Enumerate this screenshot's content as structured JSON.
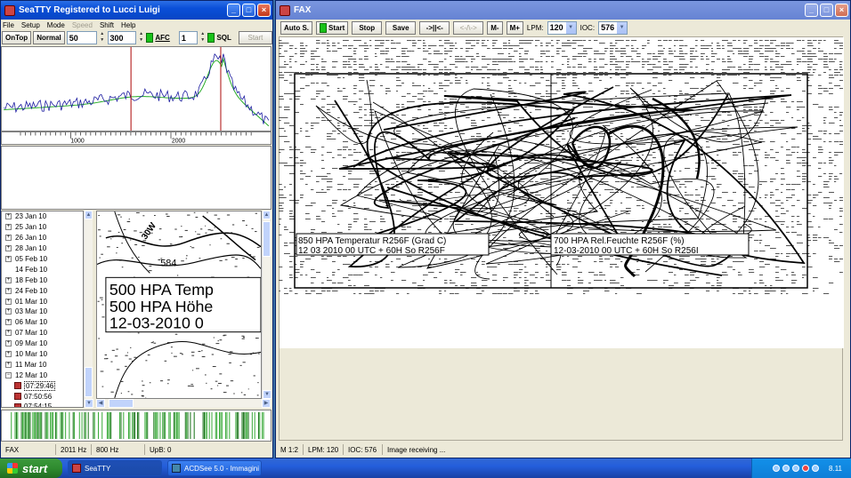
{
  "seatty": {
    "title": "SeaTTY     Registered to Lucci Luigi",
    "menu": [
      "File",
      "Setup",
      "Mode",
      "Speed",
      "Shift",
      "Help"
    ],
    "controls": {
      "ontop": "OnTop",
      "normal": "Normal",
      "value1": "50",
      "value2": "300",
      "afc": "AFC",
      "value3": "1",
      "sql": "SQL",
      "start": "Start"
    },
    "scale_labels": [
      "1000",
      "2000"
    ],
    "tree_items": [
      "23 Jan 10",
      "25 Jan 10",
      "26 Jan 10",
      "28 Jan 10",
      "05 Feb 10",
      "14 Feb 10",
      "18 Feb 10",
      "24 Feb 10",
      "01 Mar 10",
      "03 Mar 10",
      "06 Mar 10",
      "07 Mar 10",
      "09 Mar 10",
      "10 Mar 10",
      "11 Mar 10",
      "12 Mar 10"
    ],
    "tree_files": [
      "07:29:46",
      "07:50:56",
      "07:54:15"
    ],
    "preview_text": {
      "label_584": "584",
      "label_30w": "30W",
      "line1": "500 HPA Temp",
      "line2": "500 HPA Höhe",
      "line3": "12-03-2010 0"
    },
    "status": {
      "mode": "FAX",
      "freq": "2011 Hz",
      "shift": "800 Hz",
      "upb": "UpB: 0"
    }
  },
  "fax": {
    "title": "FAX",
    "toolbar": {
      "auto": "Auto S.",
      "start": "Start",
      "stop": "Stop",
      "save": "Save",
      "fwd": "->||<-",
      "back": "<-/\\->",
      "mminus": "M-",
      "mplus": "M+",
      "lpm_label": "LPM:",
      "lpm_value": "120",
      "ioc_label": "IOC:",
      "ioc_value": "576"
    },
    "map_labels": {
      "left_line1": "850 HPA Temperatur R256F (Grad C)",
      "left_line2": "12 03 2010 00 UTC + 60H So R256F",
      "right_line1": "700 HPA Rel.Feuchte R256F (%)",
      "right_line2": "12-03-2010 00 UTC + 60H So R256I"
    },
    "status": {
      "zoom": "M 1:2",
      "lpm": "LPM: 120",
      "ioc": "IOC: 576",
      "state": "Image receiving ..."
    }
  },
  "taskbar": {
    "start": "start",
    "items": [
      "SeaTTY",
      "ACDSee 5.0 - Immagini"
    ],
    "clock": "8.11"
  },
  "colors": {
    "titlebar": "#0a4fd8",
    "desktop": "#3a6ea5",
    "spectrum_blue": "#1a1aa0",
    "spectrum_green": "#22aa22",
    "marker_red": "#aa0000",
    "led_green": "#19c219"
  }
}
